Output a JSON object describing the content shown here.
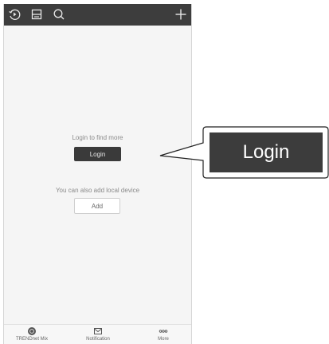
{
  "content": {
    "login_hint": "Login to find more",
    "login_button": "Login",
    "local_hint": "You can also add local device",
    "add_button": "Add"
  },
  "tabs": [
    {
      "label": "TRENDnet Mix",
      "icon": "home-icon"
    },
    {
      "label": "Notification",
      "icon": "mail-icon"
    },
    {
      "label": "More",
      "icon": "more-icon"
    }
  ],
  "topbar_icons": [
    "refresh-icon",
    "layout-icon",
    "search-icon",
    "add-icon"
  ],
  "callout": {
    "label": "Login"
  },
  "colors": {
    "topbar": "#3d3d3d",
    "button": "#3a3a3a",
    "background": "#f5f5f5"
  }
}
